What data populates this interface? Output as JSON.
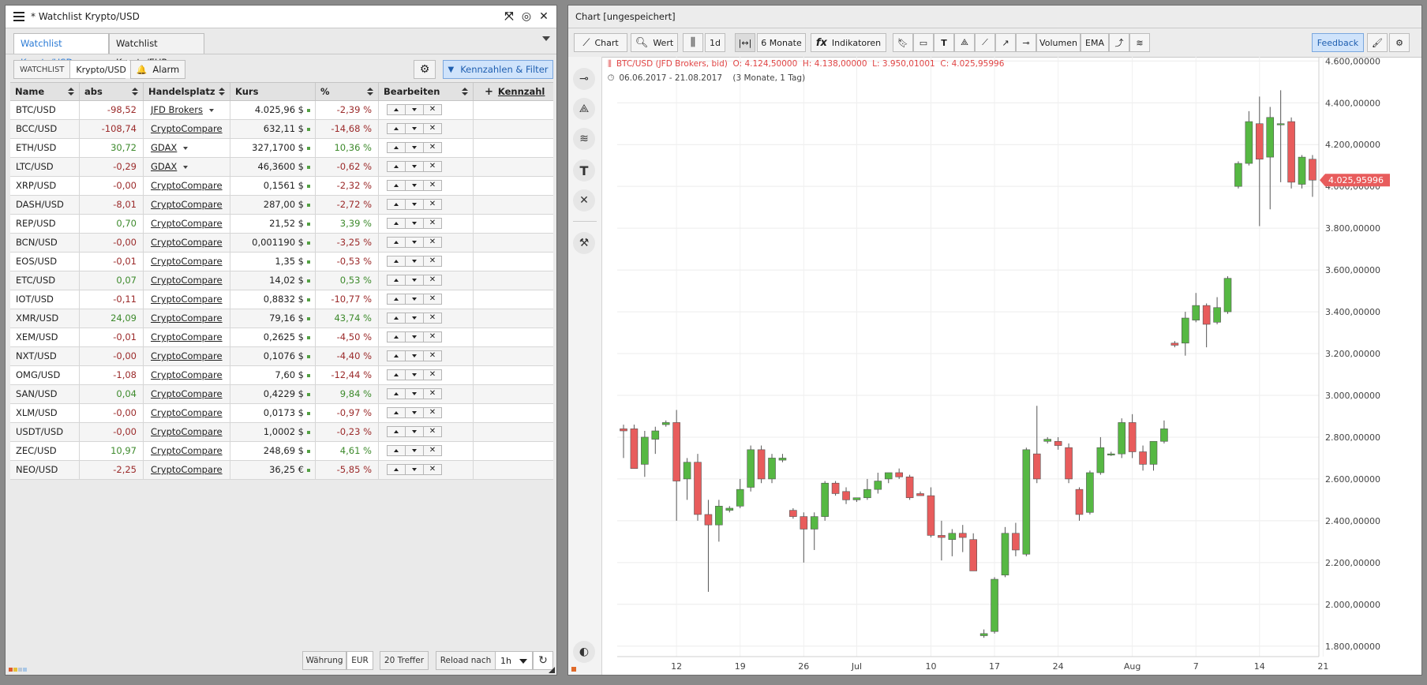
{
  "watchlist": {
    "title": "* Watchlist Krypto/USD",
    "tabs": [
      {
        "label": "Watchlist Krypto/USD",
        "active": true
      },
      {
        "label": "Watchlist Krypto/EUR",
        "active": false
      }
    ],
    "toolbar": {
      "watchlist_label": "WATCHLIST",
      "watchlist_value": "Krypto/USD",
      "alarm_label": "Alarm",
      "filter_label": "Kennzahlen & Filter"
    },
    "columns": {
      "name": "Name",
      "abs": "abs",
      "handelsplatz": "Handelsplatz",
      "kurs": "Kurs",
      "pct": "%",
      "bearbeiten": "Bearbeiten",
      "kennzahl": "Kennzahl"
    },
    "rows": [
      {
        "name": "BTC/USD",
        "abs": "-98,52",
        "hp": "JFD Brokers",
        "hp_dd": true,
        "kurs": "4.025,96 $",
        "pct": "-2,39 %"
      },
      {
        "name": "BCC/USD",
        "abs": "-108,74",
        "hp": "CryptoCompare",
        "hp_dd": false,
        "kurs": "632,11 $",
        "pct": "-14,68 %"
      },
      {
        "name": "ETH/USD",
        "abs": "30,72",
        "hp": "GDAX",
        "hp_dd": true,
        "kurs": "327,1700 $",
        "pct": "10,36 %"
      },
      {
        "name": "LTC/USD",
        "abs": "-0,29",
        "hp": "GDAX",
        "hp_dd": true,
        "kurs": "46,3600 $",
        "pct": "-0,62 %"
      },
      {
        "name": "XRP/USD",
        "abs": "-0,00",
        "hp": "CryptoCompare",
        "hp_dd": false,
        "kurs": "0,1561 $",
        "pct": "-2,32 %"
      },
      {
        "name": "DASH/USD",
        "abs": "-8,01",
        "hp": "CryptoCompare",
        "hp_dd": false,
        "kurs": "287,00 $",
        "pct": "-2,72 %"
      },
      {
        "name": "REP/USD",
        "abs": "0,70",
        "hp": "CryptoCompare",
        "hp_dd": false,
        "kurs": "21,52 $",
        "pct": "3,39 %"
      },
      {
        "name": "BCN/USD",
        "abs": "-0,00",
        "hp": "CryptoCompare",
        "hp_dd": false,
        "kurs": "0,001190 $",
        "pct": "-3,25 %"
      },
      {
        "name": "EOS/USD",
        "abs": "-0,01",
        "hp": "CryptoCompare",
        "hp_dd": false,
        "kurs": "1,35 $",
        "pct": "-0,53 %"
      },
      {
        "name": "ETC/USD",
        "abs": "0,07",
        "hp": "CryptoCompare",
        "hp_dd": false,
        "kurs": "14,02 $",
        "pct": "0,53 %"
      },
      {
        "name": "IOT/USD",
        "abs": "-0,11",
        "hp": "CryptoCompare",
        "hp_dd": false,
        "kurs": "0,8832 $",
        "pct": "-10,77 %"
      },
      {
        "name": "XMR/USD",
        "abs": "24,09",
        "hp": "CryptoCompare",
        "hp_dd": false,
        "kurs": "79,16 $",
        "pct": "43,74 %"
      },
      {
        "name": "XEM/USD",
        "abs": "-0,01",
        "hp": "CryptoCompare",
        "hp_dd": false,
        "kurs": "0,2625 $",
        "pct": "-4,50 %"
      },
      {
        "name": "NXT/USD",
        "abs": "-0,00",
        "hp": "CryptoCompare",
        "hp_dd": false,
        "kurs": "0,1076 $",
        "pct": "-4,40 %"
      },
      {
        "name": "OMG/USD",
        "abs": "-1,08",
        "hp": "CryptoCompare",
        "hp_dd": false,
        "kurs": "7,60 $",
        "pct": "-12,44 %"
      },
      {
        "name": "SAN/USD",
        "abs": "0,04",
        "hp": "CryptoCompare",
        "hp_dd": false,
        "kurs": "0,4229 $",
        "pct": "9,84 %"
      },
      {
        "name": "XLM/USD",
        "abs": "-0,00",
        "hp": "CryptoCompare",
        "hp_dd": false,
        "kurs": "0,0173 $",
        "pct": "-0,97 %"
      },
      {
        "name": "USDT/USD",
        "abs": "-0,00",
        "hp": "CryptoCompare",
        "hp_dd": false,
        "kurs": "1,0002 $",
        "pct": "-0,23 %"
      },
      {
        "name": "ZEC/USD",
        "abs": "10,97",
        "hp": "CryptoCompare",
        "hp_dd": false,
        "kurs": "248,69 $",
        "pct": "4,61 %"
      },
      {
        "name": "NEO/USD",
        "abs": "-2,25",
        "hp": "CryptoCompare",
        "hp_dd": false,
        "kurs": "36,25 €",
        "pct": "-5,85 %"
      }
    ],
    "footer": {
      "currency_label": "Währung",
      "currency_value": "EUR",
      "hits": "20 Treffer",
      "reload_label": "Reload nach",
      "reload_value": "1h"
    },
    "colors": {
      "negative": "#9b2a2a",
      "positive": "#3d8a2c",
      "accent": "#2a7ad5"
    }
  },
  "chart_window": {
    "title": "Chart [ungespeichert]",
    "toolbar": {
      "chart": "Chart",
      "wert": "Wert",
      "interval": "1d",
      "range": "6 Monate",
      "fx": "fx",
      "indikatoren": "Indikatoren",
      "volumen": "Volumen",
      "ema": "EMA",
      "feedback": "Feedback"
    },
    "info_line": "BTC/USD (JFD Brokers, bid)  O: 4.124,50000  H: 4.138,00000  L: 3.950,01001  C: 4.025,95996",
    "range_line": "06.06.2017 - 21.08.2017    (3 Monate, 1 Tag)",
    "price_tag": "4.025,95996",
    "left_tools": [
      "line-tool-icon",
      "triangle-tool-icon",
      "fib-tool-icon",
      "text-tool-icon",
      "remove-tool-icon",
      "hammer-icon",
      "contrast-icon"
    ]
  },
  "chart_data": {
    "type": "candlestick",
    "title": "BTC/USD (JFD Brokers, bid)",
    "ylim": [
      1750,
      4620
    ],
    "yticks": [
      {
        "v": 1800,
        "label": "1.800,00000"
      },
      {
        "v": 2000,
        "label": "2.000,00000"
      },
      {
        "v": 2200,
        "label": "2.200,00000"
      },
      {
        "v": 2400,
        "label": "2.400,00000"
      },
      {
        "v": 2600,
        "label": "2.600,00000"
      },
      {
        "v": 2800,
        "label": "2.800,00000"
      },
      {
        "v": 3000,
        "label": "3.000,00000"
      },
      {
        "v": 3200,
        "label": "3.200,00000"
      },
      {
        "v": 3400,
        "label": "3.400,00000"
      },
      {
        "v": 3600,
        "label": "3.600,00000"
      },
      {
        "v": 3800,
        "label": "3.800,00000"
      },
      {
        "v": 4000,
        "label": "4.000,00000"
      },
      {
        "v": 4200,
        "label": "4.200,00000"
      },
      {
        "v": 4400,
        "label": "4.400,00000"
      },
      {
        "v": 4600,
        "label": "4.600,00000"
      }
    ],
    "xticks": [
      {
        "i": 5,
        "label": "12"
      },
      {
        "i": 11,
        "label": "19"
      },
      {
        "i": 17,
        "label": "26"
      },
      {
        "i": 22,
        "label": "Jul"
      },
      {
        "i": 29,
        "label": "10"
      },
      {
        "i": 35,
        "label": "17"
      },
      {
        "i": 41,
        "label": "24"
      },
      {
        "i": 48,
        "label": "Aug"
      },
      {
        "i": 54,
        "label": "7"
      },
      {
        "i": 60,
        "label": "14"
      },
      {
        "i": 66,
        "label": "21"
      }
    ],
    "candles": [
      {
        "o": 2840,
        "h": 2860,
        "l": 2700,
        "c": 2830
      },
      {
        "o": 2840,
        "h": 2860,
        "l": 2650,
        "c": 2650
      },
      {
        "o": 2670,
        "h": 2830,
        "l": 2610,
        "c": 2800
      },
      {
        "o": 2790,
        "h": 2850,
        "l": 2720,
        "c": 2830
      },
      {
        "o": 2860,
        "h": 2880,
        "l": 2850,
        "c": 2870
      },
      {
        "o": 2870,
        "h": 2930,
        "l": 2400,
        "c": 2590
      },
      {
        "o": 2600,
        "h": 2700,
        "l": 2500,
        "c": 2680
      },
      {
        "o": 2680,
        "h": 2720,
        "l": 2400,
        "c": 2430
      },
      {
        "o": 2430,
        "h": 2500,
        "l": 2060,
        "c": 2380
      },
      {
        "o": 2380,
        "h": 2500,
        "l": 2300,
        "c": 2470
      },
      {
        "o": 2450,
        "h": 2470,
        "l": 2440,
        "c": 2460
      },
      {
        "o": 2470,
        "h": 2600,
        "l": 2460,
        "c": 2550
      },
      {
        "o": 2560,
        "h": 2760,
        "l": 2540,
        "c": 2740
      },
      {
        "o": 2740,
        "h": 2760,
        "l": 2580,
        "c": 2600
      },
      {
        "o": 2600,
        "h": 2720,
        "l": 2580,
        "c": 2700
      },
      {
        "o": 2690,
        "h": 2720,
        "l": 2680,
        "c": 2700
      },
      {
        "o": 2450,
        "h": 2460,
        "l": 2410,
        "c": 2420
      },
      {
        "o": 2420,
        "h": 2440,
        "l": 2200,
        "c": 2360
      },
      {
        "o": 2360,
        "h": 2440,
        "l": 2260,
        "c": 2420
      },
      {
        "o": 2420,
        "h": 2590,
        "l": 2400,
        "c": 2580
      },
      {
        "o": 2580,
        "h": 2590,
        "l": 2520,
        "c": 2530
      },
      {
        "o": 2540,
        "h": 2560,
        "l": 2480,
        "c": 2500
      },
      {
        "o": 2500,
        "h": 2510,
        "l": 2490,
        "c": 2510
      },
      {
        "o": 2510,
        "h": 2600,
        "l": 2500,
        "c": 2550
      },
      {
        "o": 2550,
        "h": 2630,
        "l": 2530,
        "c": 2590
      },
      {
        "o": 2600,
        "h": 2630,
        "l": 2580,
        "c": 2630
      },
      {
        "o": 2630,
        "h": 2650,
        "l": 2600,
        "c": 2610
      },
      {
        "o": 2610,
        "h": 2620,
        "l": 2500,
        "c": 2510
      },
      {
        "o": 2530,
        "h": 2540,
        "l": 2520,
        "c": 2520
      },
      {
        "o": 2520,
        "h": 2560,
        "l": 2320,
        "c": 2330
      },
      {
        "o": 2330,
        "h": 2400,
        "l": 2210,
        "c": 2320
      },
      {
        "o": 2310,
        "h": 2360,
        "l": 2230,
        "c": 2340
      },
      {
        "o": 2340,
        "h": 2380,
        "l": 2250,
        "c": 2320
      },
      {
        "o": 2310,
        "h": 2340,
        "l": 2160,
        "c": 2160
      },
      {
        "o": 1850,
        "h": 1880,
        "l": 1840,
        "c": 1860
      },
      {
        "o": 1870,
        "h": 2130,
        "l": 1860,
        "c": 2120
      },
      {
        "o": 2140,
        "h": 2370,
        "l": 2130,
        "c": 2340
      },
      {
        "o": 2340,
        "h": 2390,
        "l": 2230,
        "c": 2260
      },
      {
        "o": 2240,
        "h": 2750,
        "l": 2230,
        "c": 2740
      },
      {
        "o": 2720,
        "h": 2950,
        "l": 2580,
        "c": 2600
      },
      {
        "o": 2780,
        "h": 2800,
        "l": 2770,
        "c": 2790
      },
      {
        "o": 2780,
        "h": 2800,
        "l": 2740,
        "c": 2760
      },
      {
        "o": 2750,
        "h": 2770,
        "l": 2580,
        "c": 2600
      },
      {
        "o": 2550,
        "h": 2560,
        "l": 2400,
        "c": 2430
      },
      {
        "o": 2440,
        "h": 2640,
        "l": 2430,
        "c": 2630
      },
      {
        "o": 2630,
        "h": 2800,
        "l": 2620,
        "c": 2750
      },
      {
        "o": 2720,
        "h": 2730,
        "l": 2710,
        "c": 2720
      },
      {
        "o": 2720,
        "h": 2890,
        "l": 2700,
        "c": 2870
      },
      {
        "o": 2870,
        "h": 2910,
        "l": 2700,
        "c": 2730
      },
      {
        "o": 2730,
        "h": 2760,
        "l": 2640,
        "c": 2670
      },
      {
        "o": 2670,
        "h": 2780,
        "l": 2640,
        "c": 2780
      },
      {
        "o": 2780,
        "h": 2880,
        "l": 2770,
        "c": 2840
      },
      {
        "o": 3250,
        "h": 3260,
        "l": 3230,
        "c": 3240
      },
      {
        "o": 3250,
        "h": 3400,
        "l": 3190,
        "c": 3370
      },
      {
        "o": 3360,
        "h": 3490,
        "l": 3350,
        "c": 3430
      },
      {
        "o": 3430,
        "h": 3440,
        "l": 3230,
        "c": 3340
      },
      {
        "o": 3350,
        "h": 3470,
        "l": 3340,
        "c": 3420
      },
      {
        "o": 3400,
        "h": 3570,
        "l": 3390,
        "c": 3560
      },
      {
        "o": 4000,
        "h": 4120,
        "l": 3990,
        "c": 4110
      },
      {
        "o": 4110,
        "h": 4360,
        "l": 4100,
        "c": 4310
      },
      {
        "o": 4300,
        "h": 4430,
        "l": 3810,
        "c": 4130
      },
      {
        "o": 4140,
        "h": 4380,
        "l": 3890,
        "c": 4330
      },
      {
        "o": 4300,
        "h": 4460,
        "l": 4020,
        "c": 4300
      },
      {
        "o": 4310,
        "h": 4330,
        "l": 3990,
        "c": 4020
      },
      {
        "o": 4010,
        "h": 4150,
        "l": 3990,
        "c": 4140
      },
      {
        "o": 4130,
        "h": 4150,
        "l": 3950,
        "c": 4030
      }
    ],
    "colors": {
      "up": "#56b843",
      "down": "#e85c5c",
      "tag": "#e85c5c"
    }
  }
}
